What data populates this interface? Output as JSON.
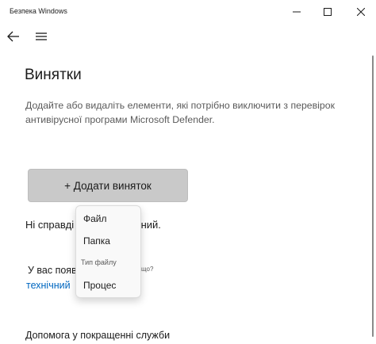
{
  "window": {
    "title": "Безпека Windows",
    "controls": [
      "minimize-icon",
      "maximize-icon",
      "close-icon"
    ]
  },
  "nav": {
    "back_icon": "back-arrow-icon",
    "menu_icon": "hamburger-menu-icon"
  },
  "page": {
    "title": "Винятки",
    "description_line1": "Додайте або видаліть елементи, які потрібно виключити з перевірок",
    "description_line2": "антивірусної програми Microsoft Defender.",
    "add_button_label": "+ Додати виняток",
    "no_exclusions_start": "Ні справді",
    "no_exclusions_end": "ючений.",
    "question_start": "У вас поява",
    "question_end": "що?",
    "tech_link": "технічний",
    "help_text": "Допомога у покращенні служби"
  },
  "flyout": {
    "item_file": "Файл",
    "item_folder": "Папка",
    "header_filetype": "Тип файлу",
    "item_process": "Процес"
  },
  "colors": {
    "link": "#0067c0",
    "button_bg": "#c9c9c9",
    "text": "#1b1b1b"
  }
}
